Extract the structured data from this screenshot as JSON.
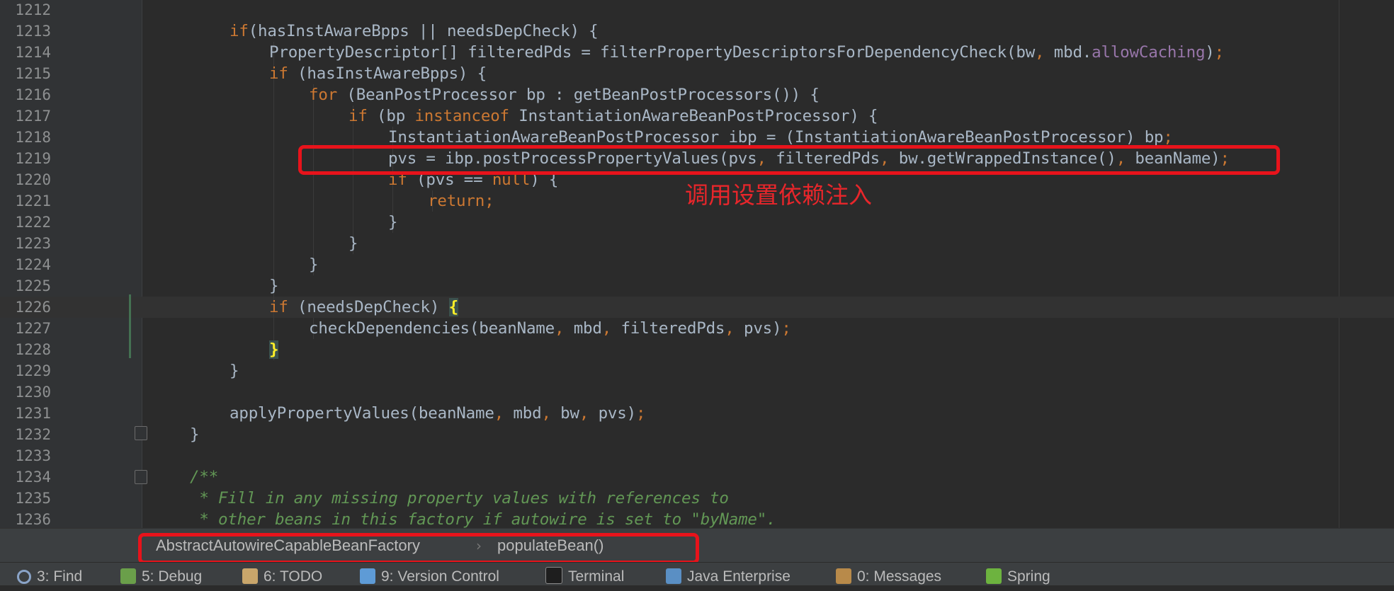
{
  "editor": {
    "lines": [
      {
        "num": "1212",
        "indent": 0,
        "tokens": []
      },
      {
        "num": "1213",
        "indent": 2,
        "tokens": [
          [
            "kw",
            "if"
          ],
          [
            "",
            "(hasInstAwareBpps || needsDepCheck) {"
          ]
        ]
      },
      {
        "num": "1214",
        "indent": 3,
        "tokens": [
          [
            "",
            "PropertyDescriptor[] filteredPds = filterPropertyDescriptorsForDependencyCheck(bw"
          ],
          [
            "kw",
            ","
          ],
          [
            "",
            " mbd."
          ],
          [
            "field",
            "allowCaching"
          ],
          [
            "",
            ")"
          ],
          [
            "kw",
            ";"
          ]
        ]
      },
      {
        "num": "1215",
        "indent": 3,
        "tokens": [
          [
            "kw",
            "if"
          ],
          [
            "",
            " (hasInstAwareBpps) {"
          ]
        ]
      },
      {
        "num": "1216",
        "indent": 4,
        "tokens": [
          [
            "kw",
            "for"
          ],
          [
            "",
            " (BeanPostProcessor bp : getBeanPostProcessors()) {"
          ]
        ]
      },
      {
        "num": "1217",
        "indent": 5,
        "tokens": [
          [
            "kw",
            "if"
          ],
          [
            "",
            " (bp "
          ],
          [
            "kw",
            "instanceof"
          ],
          [
            "",
            " InstantiationAwareBeanPostProcessor) {"
          ]
        ]
      },
      {
        "num": "1218",
        "indent": 6,
        "tokens": [
          [
            "",
            "InstantiationAwareBeanPostProcessor ibp = (InstantiationAwareBeanPostProcessor) bp"
          ],
          [
            "kw",
            ";"
          ]
        ]
      },
      {
        "num": "1219",
        "indent": 6,
        "tokens": [
          [
            "",
            "pvs = ibp.postProcessPropertyValues(pvs"
          ],
          [
            "kw",
            ","
          ],
          [
            "",
            " filteredPds"
          ],
          [
            "kw",
            ","
          ],
          [
            "",
            " bw.getWrappedInstance()"
          ],
          [
            "kw",
            ","
          ],
          [
            "",
            " beanName)"
          ],
          [
            "kw",
            ";"
          ]
        ]
      },
      {
        "num": "1220",
        "indent": 6,
        "tokens": [
          [
            "kw",
            "if"
          ],
          [
            "",
            " (pvs == "
          ],
          [
            "kw",
            "null"
          ],
          [
            "",
            ") {"
          ]
        ]
      },
      {
        "num": "1221",
        "indent": 7,
        "tokens": [
          [
            "kw",
            "return;"
          ]
        ]
      },
      {
        "num": "1222",
        "indent": 6,
        "tokens": [
          [
            "",
            "}"
          ]
        ]
      },
      {
        "num": "1223",
        "indent": 5,
        "tokens": [
          [
            "",
            "}"
          ]
        ]
      },
      {
        "num": "1224",
        "indent": 4,
        "tokens": [
          [
            "",
            "}"
          ]
        ]
      },
      {
        "num": "1225",
        "indent": 3,
        "tokens": [
          [
            "",
            "}"
          ]
        ]
      },
      {
        "num": "1226",
        "indent": 3,
        "tokens": [
          [
            "kw",
            "if"
          ],
          [
            "",
            " (needsDepCheck) "
          ],
          [
            "brace-hl",
            "{"
          ]
        ]
      },
      {
        "num": "1227",
        "indent": 4,
        "tokens": [
          [
            "",
            "checkDependencies(beanName"
          ],
          [
            "kw",
            ","
          ],
          [
            "",
            " mbd"
          ],
          [
            "kw",
            ","
          ],
          [
            "",
            " filteredPds"
          ],
          [
            "kw",
            ","
          ],
          [
            "",
            " pvs)"
          ],
          [
            "kw",
            ";"
          ]
        ]
      },
      {
        "num": "1228",
        "indent": 3,
        "tokens": [
          [
            "brace-hl",
            "}"
          ]
        ]
      },
      {
        "num": "1229",
        "indent": 2,
        "tokens": [
          [
            "",
            "}"
          ]
        ]
      },
      {
        "num": "1230",
        "indent": 0,
        "tokens": []
      },
      {
        "num": "1231",
        "indent": 2,
        "tokens": [
          [
            "",
            "applyPropertyValues(beanName"
          ],
          [
            "kw",
            ","
          ],
          [
            "",
            " mbd"
          ],
          [
            "kw",
            ","
          ],
          [
            "",
            " bw"
          ],
          [
            "kw",
            ","
          ],
          [
            "",
            " pvs)"
          ],
          [
            "kw",
            ";"
          ]
        ]
      },
      {
        "num": "1232",
        "indent": 1,
        "tokens": [
          [
            "",
            "}"
          ]
        ]
      },
      {
        "num": "1233",
        "indent": 0,
        "tokens": []
      },
      {
        "num": "1234",
        "indent": 1,
        "tokens": [
          [
            "doc",
            "/**"
          ]
        ]
      },
      {
        "num": "1235",
        "indent": 1,
        "tokens": [
          [
            "doc",
            " * Fill in any missing property values with references to"
          ]
        ]
      },
      {
        "num": "1236",
        "indent": 1,
        "tokens": [
          [
            "doc",
            " * other beans in this factory if autowire is set to \"byName\"."
          ]
        ]
      }
    ],
    "annotation_text": "调用设置依赖注入"
  },
  "breadcrumb": {
    "class_name": "AbstractAutowireCapableBeanFactory",
    "separator": "›",
    "method_name": "populateBean()"
  },
  "tool_windows": [
    {
      "label": "3: Find",
      "icon": "search-icon",
      "color": "#8aa4c8"
    },
    {
      "label": "5: Debug",
      "icon": "bug-icon",
      "color": "#6a9f4a"
    },
    {
      "label": "6: TODO",
      "icon": "todo-icon",
      "color": "#c9a66b"
    },
    {
      "label": "9: Version Control",
      "icon": "version-control-icon",
      "color": "#5e9bd6"
    },
    {
      "label": "Terminal",
      "icon": "terminal-icon",
      "color": "#1e1e1e"
    },
    {
      "label": "Java Enterprise",
      "icon": "java-enterprise-icon",
      "color": "#5a8fc4"
    },
    {
      "label": "0: Messages",
      "icon": "messages-icon",
      "color": "#b88a4a"
    },
    {
      "label": "Spring",
      "icon": "spring-leaf-icon",
      "color": "#6db33f"
    }
  ],
  "colors": {
    "highlight_box": "#e8131b",
    "keyword": "#cc7832",
    "field": "#9876aa",
    "doc_comment": "#629755",
    "default_text": "#a9b7c6",
    "background": "#2b2b2b"
  }
}
